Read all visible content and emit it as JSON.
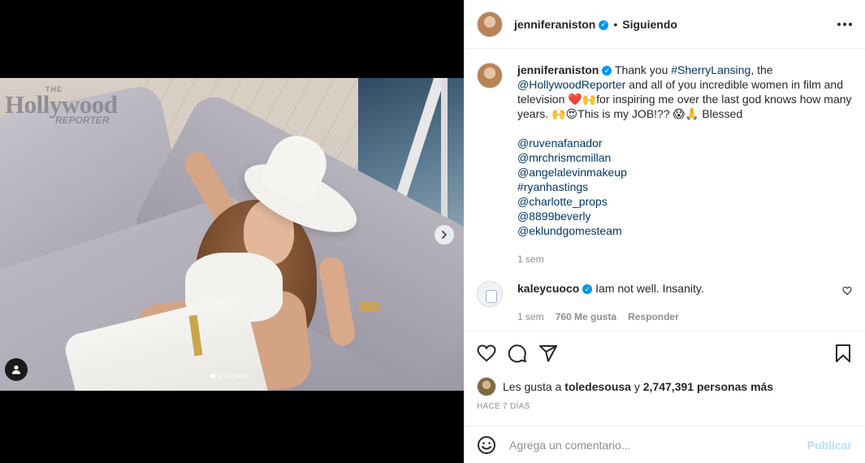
{
  "media": {
    "logo": {
      "the": "THE",
      "main": "Hollywood",
      "sub": "REPORTER"
    },
    "carousel_total": 5,
    "carousel_active": 1
  },
  "header": {
    "username": "jenniferaniston",
    "separator": "•",
    "follow_status": "Siguiendo"
  },
  "caption": {
    "username": "jenniferaniston",
    "segments": [
      {
        "text": " Thank you ",
        "tag": false
      },
      {
        "text": "#SherryLansing",
        "tag": true
      },
      {
        "text": ", the ",
        "tag": false
      },
      {
        "text": "@HollywoodReporter",
        "tag": true
      },
      {
        "text": " and all of you incredible women in film and television ",
        "tag": false
      },
      {
        "text": "❤️🙌",
        "tag": false
      },
      {
        "text": "for inspiring me over the last god knows how many years. ",
        "tag": false
      },
      {
        "text": "🙌😍",
        "tag": false
      },
      {
        "text": "This is my JOB!?? ",
        "tag": false
      },
      {
        "text": "😱🙏",
        "tag": false
      },
      {
        "text": " Blessed",
        "tag": false
      }
    ],
    "mentions": [
      "@ruvenafanador",
      "@mrchrismcmillan",
      "@angelalevinmakeup",
      "#ryanhastings",
      "@charlotte_props",
      "@8899beverly",
      "@eklundgomesteam"
    ],
    "time": "1 sem"
  },
  "comment": {
    "username": "kaleycuoco",
    "text": "Iam not well. Insanity.",
    "time": "1 sem",
    "likes": "760 Me gusta",
    "reply": "Responder"
  },
  "likes": {
    "prefix": "Les gusta a ",
    "user": "toledesousa",
    "middle": " y ",
    "count": "2,747,391 personas más"
  },
  "posted_ago": "HACE 7 DÍAS",
  "add_comment": {
    "placeholder": "Agrega un comentario...",
    "publish": "Publicar"
  },
  "colors": {
    "link": "#00376b",
    "verified": "#0095f6",
    "muted": "#8e8e8e",
    "publish_disabled": "#b2dffc"
  },
  "icons": [
    "chevron-right-icon",
    "user-tag-icon",
    "heart-icon",
    "comment-icon",
    "share-icon",
    "bookmark-icon",
    "emoji-icon",
    "more-icon",
    "verified-icon"
  ]
}
